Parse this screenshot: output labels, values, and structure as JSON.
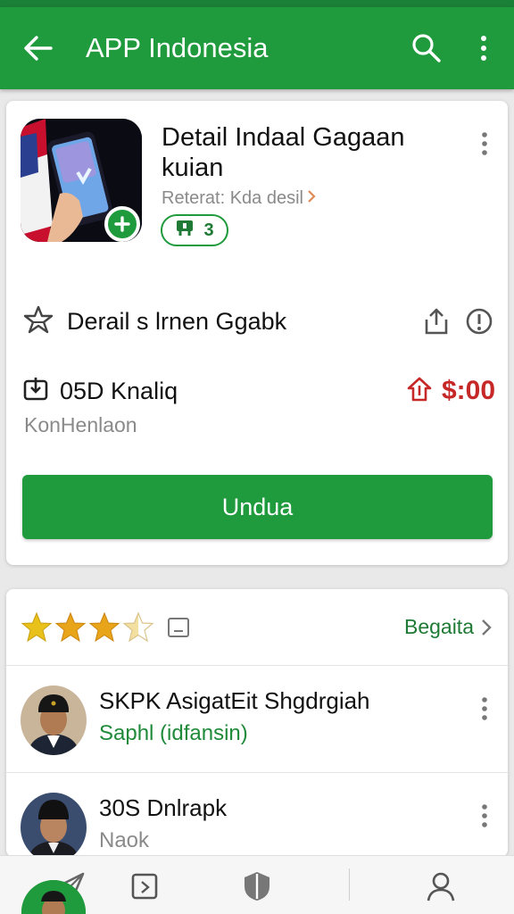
{
  "appbar": {
    "title": "APP Indonesia",
    "icons": [
      "back-arrow-icon",
      "search-icon",
      "more-vert-icon"
    ]
  },
  "app": {
    "name": "Detail Indaal Gagaan kuian",
    "subtitle": "Reterat: Kda desil",
    "chip_label": "3",
    "install_label": "Undua"
  },
  "details": {
    "row1_label": "Derail s lrnen Ggabk",
    "row2_label": "05D Knaliq",
    "price": "$:00",
    "row2_sub": "KonHenlaon"
  },
  "reviews": {
    "rating": 3.5,
    "max_rating": 5,
    "see_all": "Begaita",
    "items": [
      {
        "title": "SKPK AsigatEit Shgdrgiah",
        "subtitle": "Saphl (idfansin)"
      },
      {
        "title": "30S Dnlrapk",
        "subtitle": "Naok"
      }
    ]
  },
  "colors": {
    "brand_green": "#1f9a3c",
    "price_red": "#c62828"
  },
  "bottomnav": {
    "icons": [
      "send-icon",
      "image-icon",
      "shield-icon",
      "account-icon"
    ]
  }
}
